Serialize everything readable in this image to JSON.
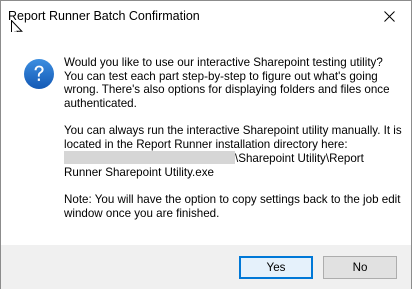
{
  "window": {
    "title": "Report Runner Batch Confirmation"
  },
  "icons": {
    "close": "close-icon",
    "dialog": "info-question-icon",
    "cursor": "mouse-pointer-icon"
  },
  "message": {
    "paragraph1": "Would you like to use our interactive Sharepoint testing utility? You can test each part step-by-step to figure out what's going wrong. There's also options for displaying folders and files once authenticated.",
    "paragraph2_intro": "You can always run the interactive Sharepoint utility manually. It is located in the Report Runner installation directory here:",
    "path_suffix": "\\Sharepoint Utility\\Report Runner Sharepoint Utility.exe",
    "paragraph3": "Note: You will have the option to copy settings back to the job edit window once you are finished."
  },
  "buttons": {
    "yes": "Yes",
    "no": "No"
  },
  "colors": {
    "accent": "#0078d7",
    "icon_bg": "#1c6fc4",
    "footer_bg": "#f0f0f0"
  }
}
